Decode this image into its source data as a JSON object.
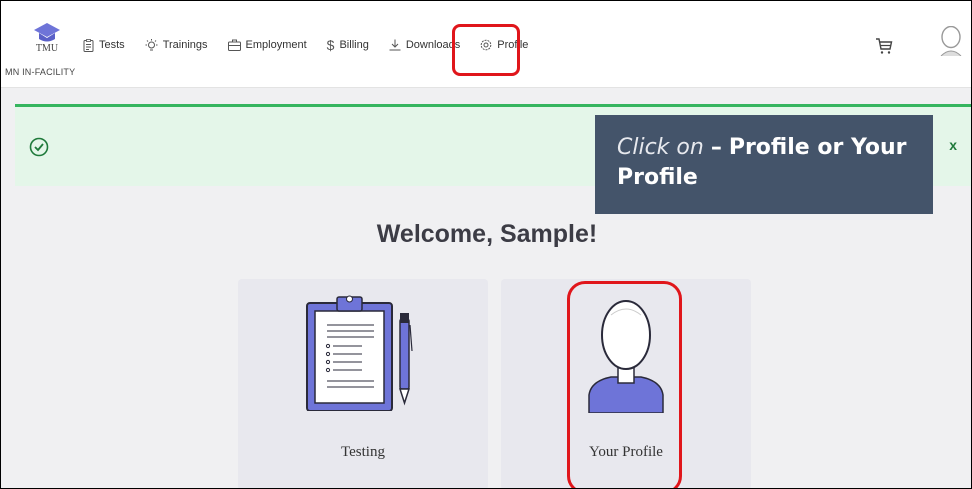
{
  "brand": {
    "logo_text": "TMU",
    "facility": "MN IN-FACILITY"
  },
  "nav": {
    "items": [
      {
        "label": "Tests",
        "icon": "clipboard-icon"
      },
      {
        "label": "Trainings",
        "icon": "lightbulb-icon"
      },
      {
        "label": "Employment",
        "icon": "briefcase-icon"
      },
      {
        "label": "Billing",
        "icon": "dollar-icon"
      },
      {
        "label": "Downloads",
        "icon": "download-icon"
      },
      {
        "label": "Profile",
        "icon": "gear-icon"
      }
    ],
    "cart_icon": "cart-icon",
    "avatar_icon": "user-avatar-icon"
  },
  "banner": {
    "icon": "check-circle-icon",
    "close_label": "x"
  },
  "tooltip": {
    "action": "Click on",
    "dash": "–",
    "text": "Profile or Your Profile"
  },
  "welcome": "Welcome, Sample!",
  "cards": [
    {
      "label": "Testing",
      "icon": "clipboard-icon"
    },
    {
      "label": "Your Profile",
      "icon": "person-icon"
    }
  ],
  "colors": {
    "accent": "#6e74d8",
    "banner_bg": "#e4f6e9",
    "banner_border": "#36b55f",
    "highlight": "#e0161b",
    "tooltip_bg": "#44546a"
  }
}
